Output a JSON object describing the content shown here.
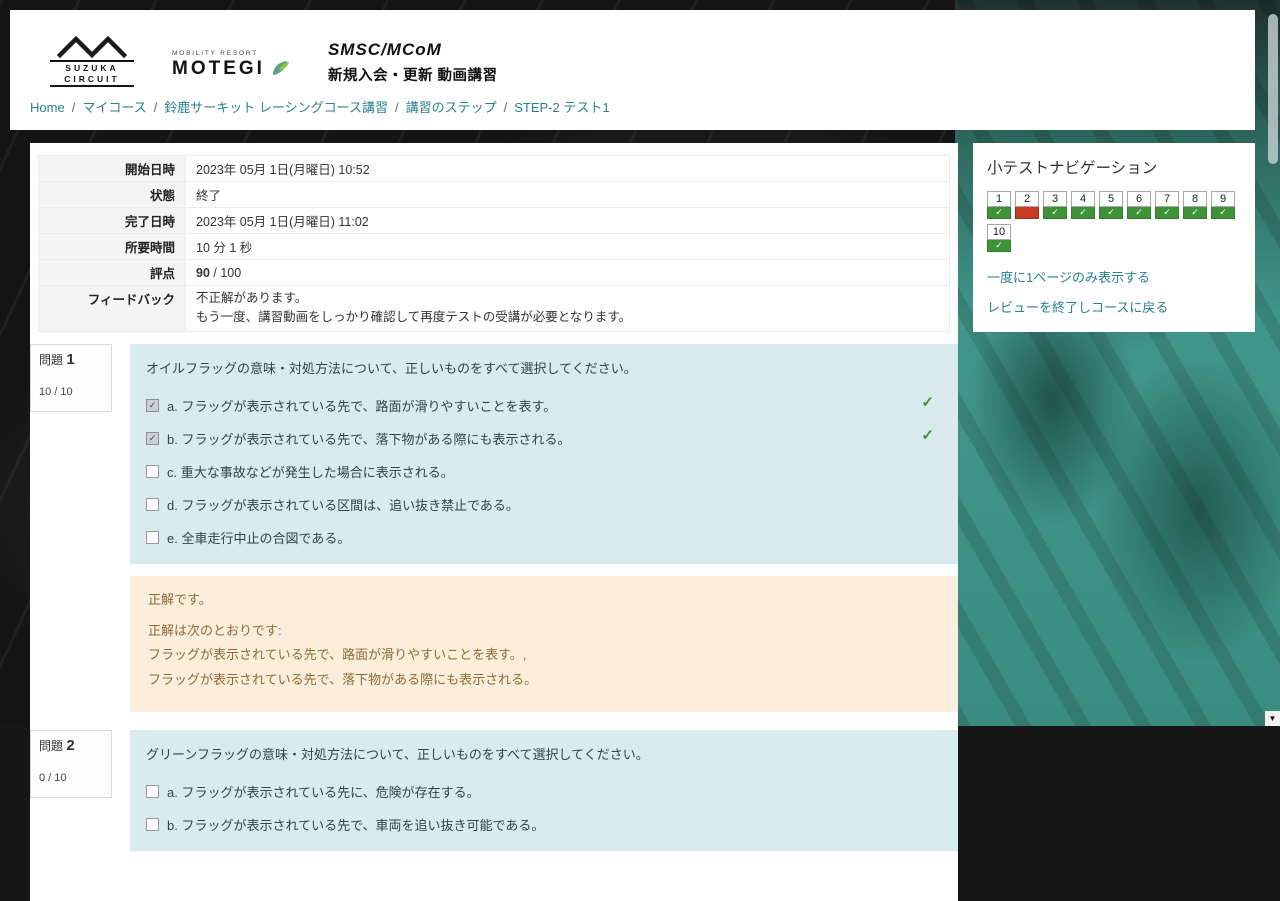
{
  "icons": {
    "check": "✓",
    "down_arrow": "▼"
  },
  "header": {
    "suzuka": {
      "line1": "SUZUKA",
      "line2": "CIRCUIT"
    },
    "motegi": {
      "small": "MOBILITY RESORT",
      "large": "MOTEGI"
    },
    "title": {
      "line1": "SMSC/MCoM",
      "line2": "新規入会・更新 動画講習"
    }
  },
  "breadcrumb": {
    "sep": "/",
    "items": [
      "Home",
      "マイコース",
      "鈴鹿サーキット レーシングコース講習",
      "講習のステップ",
      "STEP-2  テスト1"
    ]
  },
  "summary": {
    "rows": [
      {
        "label": "開始日時",
        "value": "2023年 05月 1日(月曜日) 10:52"
      },
      {
        "label": "状態",
        "value": "終了"
      },
      {
        "label": "完了日時",
        "value": "2023年 05月 1日(月曜日) 11:02"
      },
      {
        "label": "所要時間",
        "value": "10 分 1 秒"
      },
      {
        "label": "評点",
        "value_bold": "90",
        "value_rest": " / 100"
      },
      {
        "label": "フィードバック",
        "line1": "不正解があります。",
        "line2": "もう一度、講習動画をしっかり確認して再度テストの受講が必要となります。"
      }
    ]
  },
  "quiz_nav": {
    "title": "小テストナビゲーション",
    "buttons": [
      {
        "num": "1",
        "state": "correct"
      },
      {
        "num": "2",
        "state": "incorrect"
      },
      {
        "num": "3",
        "state": "correct"
      },
      {
        "num": "4",
        "state": "correct"
      },
      {
        "num": "5",
        "state": "correct"
      },
      {
        "num": "6",
        "state": "correct"
      },
      {
        "num": "7",
        "state": "correct"
      },
      {
        "num": "8",
        "state": "correct"
      },
      {
        "num": "9",
        "state": "correct"
      },
      {
        "num": "10",
        "state": "correct"
      }
    ],
    "links": [
      "一度に1ページのみ表示する",
      "レビューを終了しコースに戻る"
    ]
  },
  "questions": [
    {
      "label": "問題",
      "number": "1",
      "grade": "10 / 10",
      "text": "オイルフラッグの意味・対処方法について、正しいものをすべて選択してください。",
      "options": [
        {
          "text": "a. フラッグが表示されている先で、路面が滑りやすいことを表す。",
          "checked": true,
          "mark": "correct"
        },
        {
          "text": "b. フラッグが表示されている先で、落下物がある際にも表示される。",
          "checked": true,
          "mark": "correct"
        },
        {
          "text": "c. 重大な事故などが発生した場合に表示される。",
          "checked": false,
          "mark": "none"
        },
        {
          "text": "d. フラッグが表示されている区間は、追い抜き禁止である。",
          "checked": false,
          "mark": "none"
        },
        {
          "text": "e. 全車走行中止の合図である。",
          "checked": false,
          "mark": "none"
        }
      ],
      "feedback": {
        "line1": "正解です。",
        "line2": "正解は次のとおりです:",
        "answers": [
          "フラッグが表示されている先で、路面が滑りやすいことを表す。,",
          "フラッグが表示されている先で、落下物がある際にも表示される。"
        ]
      }
    },
    {
      "label": "問題",
      "number": "2",
      "grade": "0 / 10",
      "text": "グリーンフラッグの意味・対処方法について、正しいものをすべて選択してください。",
      "options": [
        {
          "text": "a. フラッグが表示されている先に、危険が存在する。",
          "checked": false,
          "mark": "none"
        },
        {
          "text": "b. フラッグが表示されている先で、車両を追い抜き可能である。",
          "checked": false,
          "mark": "none"
        }
      ]
    }
  ]
}
